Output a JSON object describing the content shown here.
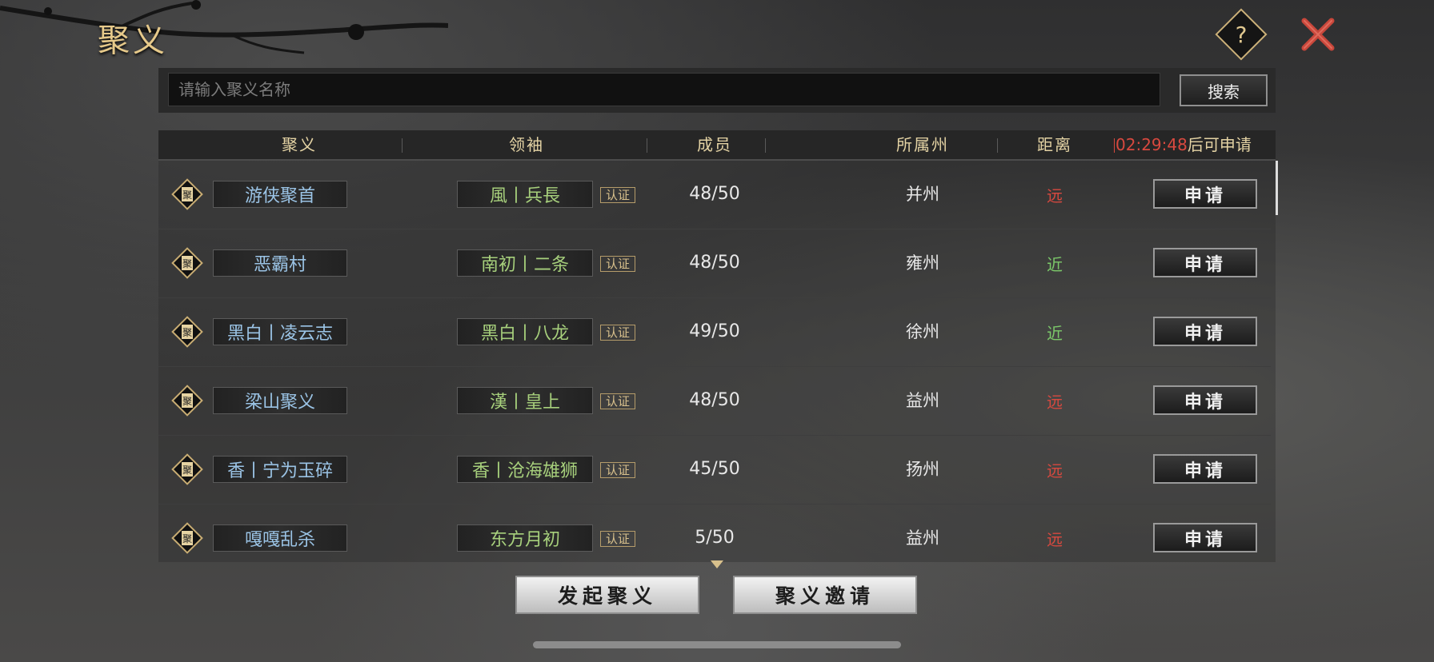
{
  "header": {
    "title": "聚义",
    "help_label": "?"
  },
  "search": {
    "placeholder": "请输入聚义名称",
    "value": "",
    "button_label": "搜索"
  },
  "columns": {
    "alliance": "聚义",
    "leader": "领袖",
    "members": "成员",
    "state": "所属州",
    "distance": "距离"
  },
  "cooldown": {
    "timer": "02:29:48",
    "suffix": "后可申请"
  },
  "rows": [
    {
      "badge": "聚",
      "name": "游侠聚首",
      "leader": "風丨兵長",
      "cert": "认证",
      "members": "48/50",
      "state": "并州",
      "distance": "远",
      "apply": "申请"
    },
    {
      "badge": "聚",
      "name": "恶霸村",
      "leader": "南初丨二条",
      "cert": "认证",
      "members": "48/50",
      "state": "雍州",
      "distance": "近",
      "apply": "申请"
    },
    {
      "badge": "聚",
      "name": "黑白丨凌云志",
      "leader": "黑白丨八龙",
      "cert": "认证",
      "members": "49/50",
      "state": "徐州",
      "distance": "近",
      "apply": "申请"
    },
    {
      "badge": "聚",
      "name": "梁山聚义",
      "leader": "漢丨皇上",
      "cert": "认证",
      "members": "48/50",
      "state": "益州",
      "distance": "远",
      "apply": "申请"
    },
    {
      "badge": "聚",
      "name": "香丨宁为玉碎",
      "leader": "香丨沧海雄狮",
      "cert": "认证",
      "members": "45/50",
      "state": "扬州",
      "distance": "远",
      "apply": "申请"
    },
    {
      "badge": "聚",
      "name": "嘎嘎乱杀",
      "leader": "东方月初",
      "cert": "认证",
      "members": "5/50",
      "state": "益州",
      "distance": "远",
      "apply": "申请"
    }
  ],
  "footer": {
    "start_label": "发起聚义",
    "invite_label": "聚义邀请"
  },
  "colors": {
    "far": "#d8493f",
    "near": "#7cc96a",
    "title_gold": "#e6c98a"
  }
}
